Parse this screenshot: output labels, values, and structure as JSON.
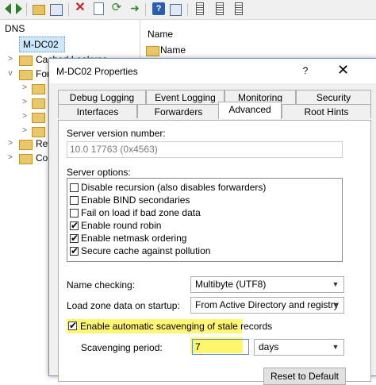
{
  "toolbar": {
    "icons": [
      "back-arrow-icon",
      "forward-arrow-icon",
      "folder-up-icon",
      "show-hide-tree-icon",
      "delete-icon",
      "properties-icon",
      "refresh-icon",
      "export-list-icon",
      "help-icon",
      "help-topics-icon",
      "record-list-icon",
      "record-list-icon",
      "record-list-icon"
    ]
  },
  "tree": {
    "root_label": "DNS",
    "server_label": "M-DC02",
    "items": [
      {
        "label": "Cached Lookups"
      },
      {
        "label": "For"
      },
      {
        "label": ""
      },
      {
        "label": ""
      },
      {
        "label": ""
      },
      {
        "label": ""
      },
      {
        "label": "Rev"
      },
      {
        "label": "Con"
      }
    ]
  },
  "list": {
    "column_header": "Name",
    "first_item": "Name"
  },
  "dialog": {
    "title": "M-DC02 Properties",
    "help_glyph": "?",
    "close_glyph": "✕",
    "tabs_row1": [
      "Debug Logging",
      "Event Logging",
      "Monitoring",
      "Security"
    ],
    "tabs_row2": [
      "Interfaces",
      "Forwarders",
      "Advanced",
      "Root Hints"
    ],
    "active_tab": "Advanced",
    "server_version_label": "Server version number:",
    "server_version_value": "10.0 17763 (0x4563)",
    "server_options_label": "Server options:",
    "server_options": [
      {
        "label": "Disable recursion (also disables forwarders)",
        "checked": false
      },
      {
        "label": "Enable BIND secondaries",
        "checked": false
      },
      {
        "label": "Fail on load if bad zone data",
        "checked": false
      },
      {
        "label": "Enable round robin",
        "checked": true
      },
      {
        "label": "Enable netmask ordering",
        "checked": true
      },
      {
        "label": "Secure cache against pollution",
        "checked": true
      }
    ],
    "name_checking_label": "Name checking:",
    "name_checking_value": "Multibyte (UTF8)",
    "load_zone_label": "Load zone data on startup:",
    "load_zone_value": "From Active Directory and registry",
    "scavenging_checkbox_label": "Enable automatic scavenging of stale records",
    "scavenging_checked": true,
    "scavenging_period_label": "Scavenging period:",
    "scavenging_period_value": "7",
    "scavenging_unit_value": "days",
    "reset_button_label": "Reset to Default",
    "highlight_color": "#fff65b",
    "accent_color": "#5b8fd0"
  }
}
